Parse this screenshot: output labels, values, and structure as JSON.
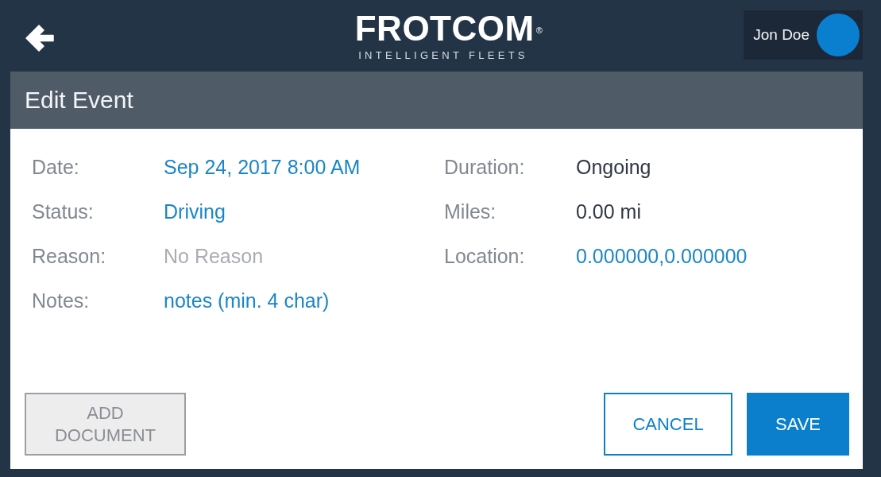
{
  "top_bar": {
    "logo": {
      "name": "FROTCOM$^{®}$",
      "tagline": "INTELLIGENT FLEETS"
    },
    "user": {
      "name": "Jon Doe"
    }
  },
  "dialog": {
    "title": "Edit Event",
    "left_fields": [
      {
        "label": "Date:",
        "value": "Sep 24, 2017 8:00 AM",
        "kind": "link"
      },
      {
        "label": "Status:",
        "value": "Driving",
        "kind": "link"
      },
      {
        "label": "Reason:",
        "value": "No Reason",
        "kind": "muted"
      },
      {
        "label": "Notes:",
        "value": "notes (min. 4 char)",
        "kind": "link"
      }
    ],
    "right_fields": [
      {
        "label": "Duration:",
        "value": "Ongoing",
        "kind": "text"
      },
      {
        "label": "Miles:",
        "value": "0.00 mi",
        "kind": "text"
      },
      {
        "label": "Location:",
        "value": "0.000000,0.000000",
        "kind": "link"
      }
    ],
    "buttons": [
      {
        "label": "ADD DOCUMENT",
        "kind": "secondary",
        "disabled": true
      },
      {
        "label": "CANCEL",
        "kind": "outline",
        "disabled": false
      },
      {
        "label": "SAVE",
        "kind": "primary",
        "disabled": false
      }
    ]
  }
}
